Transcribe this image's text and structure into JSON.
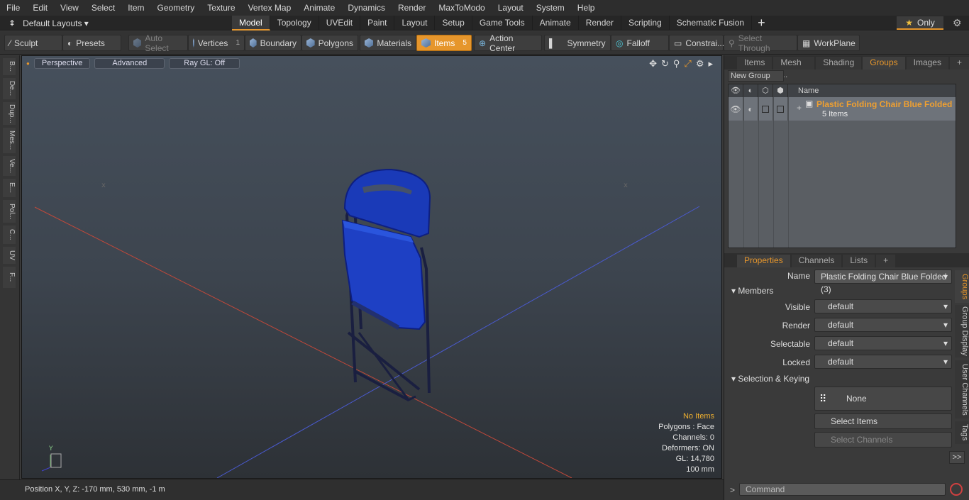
{
  "menu": [
    "File",
    "Edit",
    "View",
    "Select",
    "Item",
    "Geometry",
    "Texture",
    "Vertex Map",
    "Animate",
    "Dynamics",
    "Render",
    "MaxToModo",
    "Layout",
    "System",
    "Help"
  ],
  "layouts": {
    "label": "Default Layouts ▾"
  },
  "mode_tabs": [
    "Model",
    "Topology",
    "UVEdit",
    "Paint",
    "Layout",
    "Setup",
    "Game Tools",
    "Animate",
    "Render",
    "Scripting",
    "Schematic Fusion"
  ],
  "only_label": "Only",
  "toolbar": {
    "sculpt": "Sculpt",
    "presets": "Presets",
    "auto_select": "Auto Select",
    "vertices": "Vertices",
    "vertices_count": "1",
    "boundary": "Boundary",
    "polygons": "Polygons",
    "materials": "Materials",
    "items": "Items",
    "items_count": "5",
    "action_center": "Action Center",
    "symmetry": "Symmetry",
    "falloff": "Falloff",
    "constraints": "Constrai...",
    "select_through": "Select Through",
    "workplane": "WorkPlane"
  },
  "left_strip": [
    "B...",
    "De...",
    "Dup...",
    "Mes...",
    "Ve...",
    "E...",
    "Pol...",
    "C...",
    "UV",
    "F..."
  ],
  "viewport": {
    "perspective": "Perspective",
    "advanced": "Advanced",
    "raygl": "Ray GL: Off"
  },
  "info": {
    "no_items": "No Items",
    "polygons": "Polygons : Face",
    "channels": "Channels: 0",
    "deformers": "Deformers: ON",
    "gl": "GL: 14,780",
    "size": "100 mm"
  },
  "status": "Position X, Y, Z:   -170 mm, 530 mm, -1 m",
  "right_tabs": [
    "Items",
    "Mesh ...",
    "Shading",
    "Groups",
    "Images"
  ],
  "new_group": "New Group",
  "group_col_name": "Name",
  "group": {
    "name": "Plastic Folding Chair Blue Folded",
    "count": "5 Items"
  },
  "prop_tabs": [
    "Properties",
    "Channels",
    "Lists"
  ],
  "props": {
    "name_label": "Name",
    "name_value": "Plastic Folding Chair Blue Folded (3)",
    "members": "Members",
    "visible_label": "Visible",
    "render_label": "Render",
    "selectable_label": "Selectable",
    "locked_label": "Locked",
    "default": "default",
    "sel_keying": "Selection & Keying",
    "none": "None",
    "select_items": "Select Items",
    "select_channels": "Select Channels"
  },
  "side_tabs": [
    "Groups",
    "Group Display",
    "User Channels",
    "Tags"
  ],
  "command": "Command"
}
